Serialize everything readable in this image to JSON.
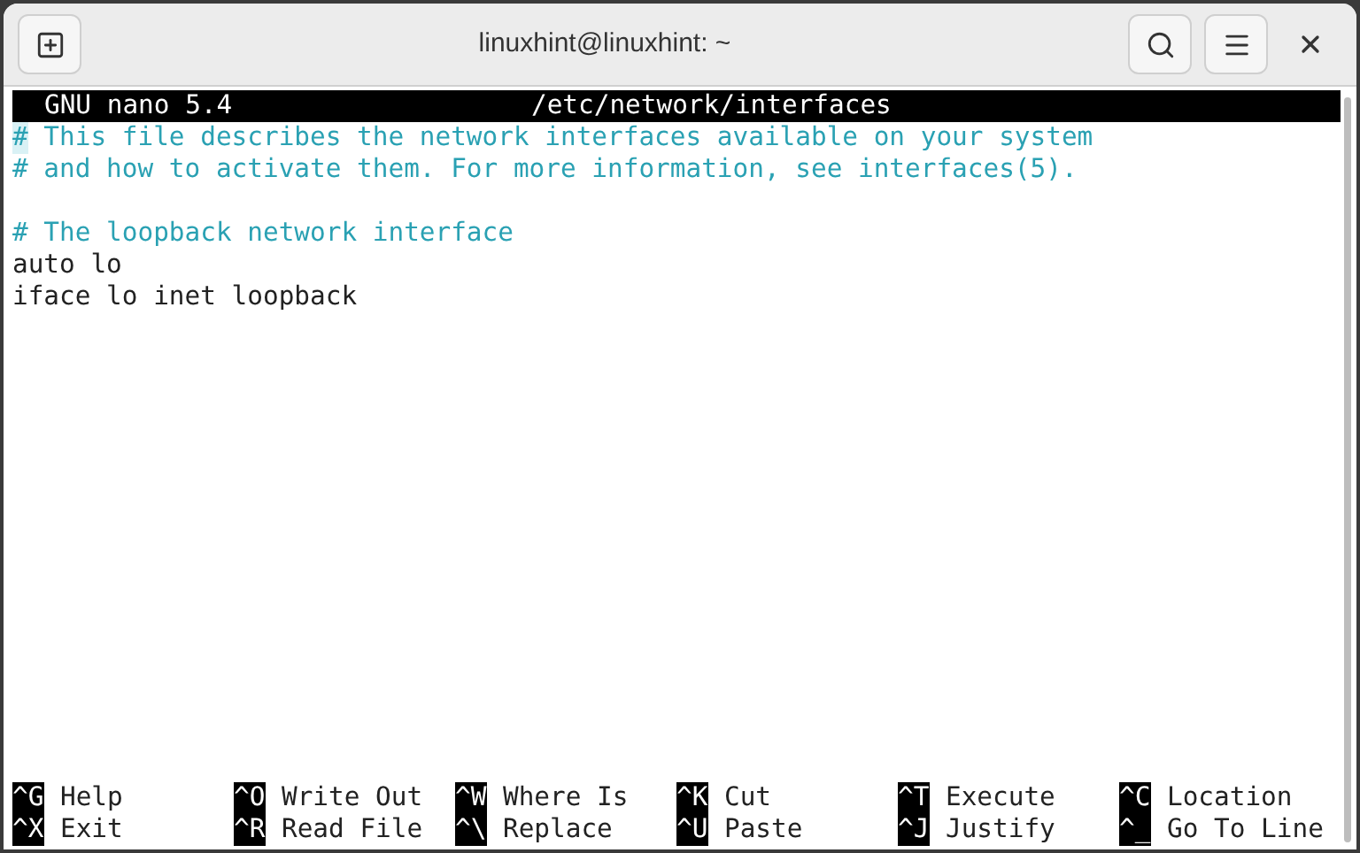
{
  "window": {
    "title": "linuxhint@linuxhint: ~"
  },
  "header": {
    "version": "GNU nano 5.4",
    "filename": "/etc/network/interfaces"
  },
  "lines": [
    {
      "kind": "comment",
      "text": "# This file describes the network interfaces available on your system",
      "cursor": true
    },
    {
      "kind": "comment",
      "text": "# and how to activate them. For more information, see interfaces(5).",
      "cursor": false
    },
    {
      "kind": "blank"
    },
    {
      "kind": "comment",
      "text": "# The loopback network interface",
      "cursor": false
    },
    {
      "kind": "code",
      "text": "auto lo",
      "cursor": false
    },
    {
      "kind": "code",
      "text": "iface lo inet loopback",
      "cursor": false
    }
  ],
  "shortcuts": [
    [
      {
        "key": "^G",
        "label": "Help"
      },
      {
        "key": "^X",
        "label": "Exit"
      }
    ],
    [
      {
        "key": "^O",
        "label": "Write Out"
      },
      {
        "key": "^R",
        "label": "Read File"
      }
    ],
    [
      {
        "key": "^W",
        "label": "Where Is"
      },
      {
        "key": "^\\",
        "label": "Replace"
      }
    ],
    [
      {
        "key": "^K",
        "label": "Cut"
      },
      {
        "key": "^U",
        "label": "Paste"
      }
    ],
    [
      {
        "key": "^T",
        "label": "Execute"
      },
      {
        "key": "^J",
        "label": "Justify"
      }
    ],
    [
      {
        "key": "^C",
        "label": "Location"
      },
      {
        "key": "^_",
        "label": "Go To Line"
      }
    ]
  ]
}
